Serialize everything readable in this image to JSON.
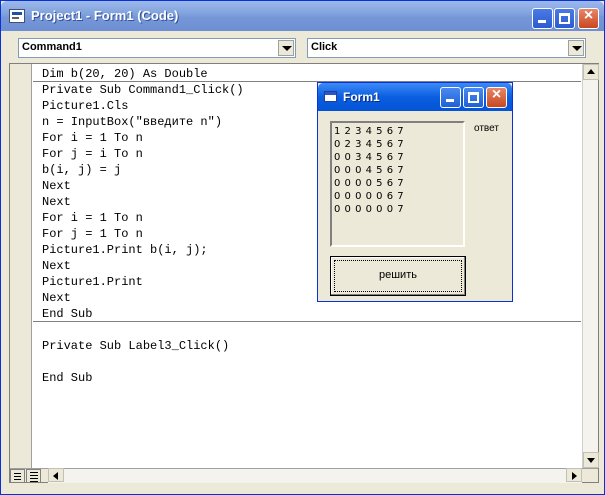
{
  "window": {
    "title": "Project1 - Form1 (Code)"
  },
  "toolbar": {
    "object_combo": "Command1",
    "procedure_combo": "Click"
  },
  "code": {
    "lines": [
      "Dim b(20, 20) As Double",
      "Private Sub Command1_Click()",
      "Picture1.Cls",
      "n = InputBox(\"введите n\")",
      "For i = 1 To n",
      "For j = i To n",
      "b(i, j) = j",
      "Next",
      "Next",
      "For i = 1 To n",
      "For j = 1 To n",
      "Picture1.Print b(i, j);",
      "Next",
      "Picture1.Print",
      "Next",
      "End Sub",
      "",
      "Private Sub Label3_Click()",
      "",
      "End Sub"
    ]
  },
  "form1": {
    "title": "Form1",
    "picture_rows": [
      "1 2 3 4 5 6 7",
      "0 2 3 4 5 6 7",
      "0 0 3 4 5 6 7",
      "0 0 0 4 5 6 7",
      "0 0 0 0 5 6 7",
      "0 0 0 0 0 6 7",
      "0 0 0 0 0 0 7"
    ],
    "answer_label": "ответ",
    "solve_button": "решить"
  },
  "icons": {
    "window_icon": "vb-code-icon",
    "form_icon": "form-icon",
    "minimize": "minimize-icon",
    "maximize": "maximize-icon",
    "close": "close-icon"
  },
  "colors": {
    "title_active": "#0a5ee0",
    "title_inactive": "#7ea0dc",
    "close": "#c84820",
    "face": "#ece9d8"
  }
}
